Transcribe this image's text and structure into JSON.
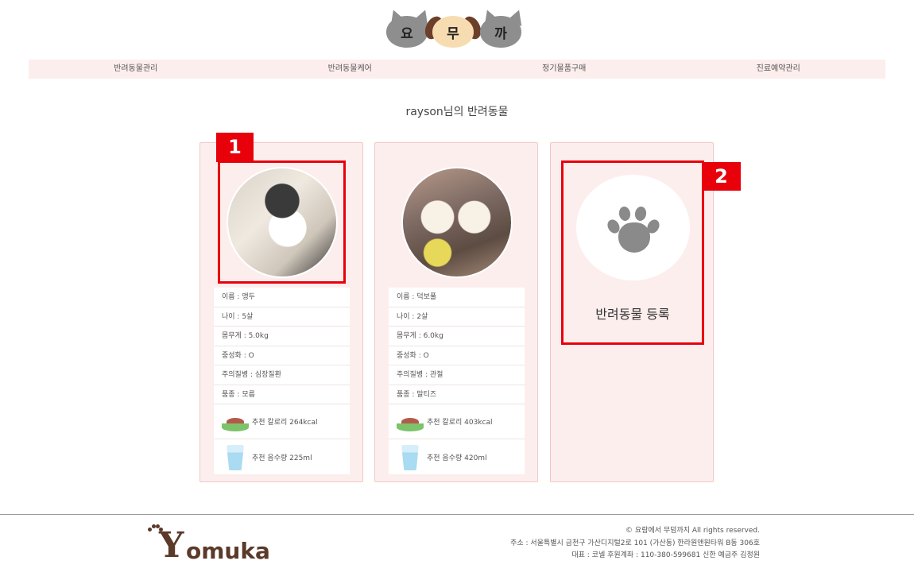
{
  "logo": {
    "chars": [
      "요",
      "무",
      "까"
    ]
  },
  "nav": {
    "items": [
      "반려동물관리",
      "반려동물케어",
      "정기물품구매",
      "진료예약관리"
    ]
  },
  "page_title": "rayson님의 반려동물",
  "pets": [
    {
      "name": "이름 : 앵두",
      "age": "나이 : 5살",
      "weight": "몸무게 : 5.0kg",
      "neutered": "중성화 : O",
      "disease": "주의질병 : 심장질환",
      "breed": "품종 : 모름",
      "calorie": "추천 칼로리 264kcal",
      "water": "추천 음수량 225ml"
    },
    {
      "name": "이름 : 덕보풀",
      "age": "나이 : 2살",
      "weight": "몸무게 : 6.0kg",
      "neutered": "중성화 : O",
      "disease": "주의질병 : 관절",
      "breed": "품종 : 말티즈",
      "calorie": "추천 칼로리 403kcal",
      "water": "추천 음수량 420ml"
    }
  ],
  "add_pet": {
    "label": "반려동물 등록"
  },
  "annotations": [
    "1",
    "2"
  ],
  "footer": {
    "brand_initial": "Y",
    "brand_rest": "omuka",
    "copyright": "© 요람에서 무덤까지 All rights reserved.",
    "address": "주소 : 서울특별시 금천구 가산디지털2로 101 (가산동) 한라원앤원타워 B동 306호",
    "rep": "대표 : 코넬 후원계좌 : 110-380-599681 신한 예금주 김정원"
  },
  "colors": {
    "accent_bg": "#fdeeee",
    "annotation": "#e8000b",
    "brand": "#5b3a2a"
  }
}
